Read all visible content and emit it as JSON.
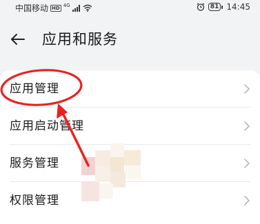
{
  "status_bar": {
    "carrier": "中国移动",
    "hd": "HD",
    "network": "4G",
    "battery": "81",
    "time": "14:45"
  },
  "header": {
    "title": "应用和服务"
  },
  "list": {
    "items": [
      {
        "label": "应用管理"
      },
      {
        "label": "应用启动管理"
      },
      {
        "label": "服务管理"
      },
      {
        "label": "权限管理"
      }
    ]
  },
  "colors": {
    "annotation": "#e8221f",
    "background": "#f1f3f5",
    "card": "#ffffff"
  },
  "icons": [
    "back-arrow-icon",
    "chevron-right-icon",
    "wifi-icon",
    "signal-icon",
    "alarm-icon",
    "battery-icon"
  ]
}
